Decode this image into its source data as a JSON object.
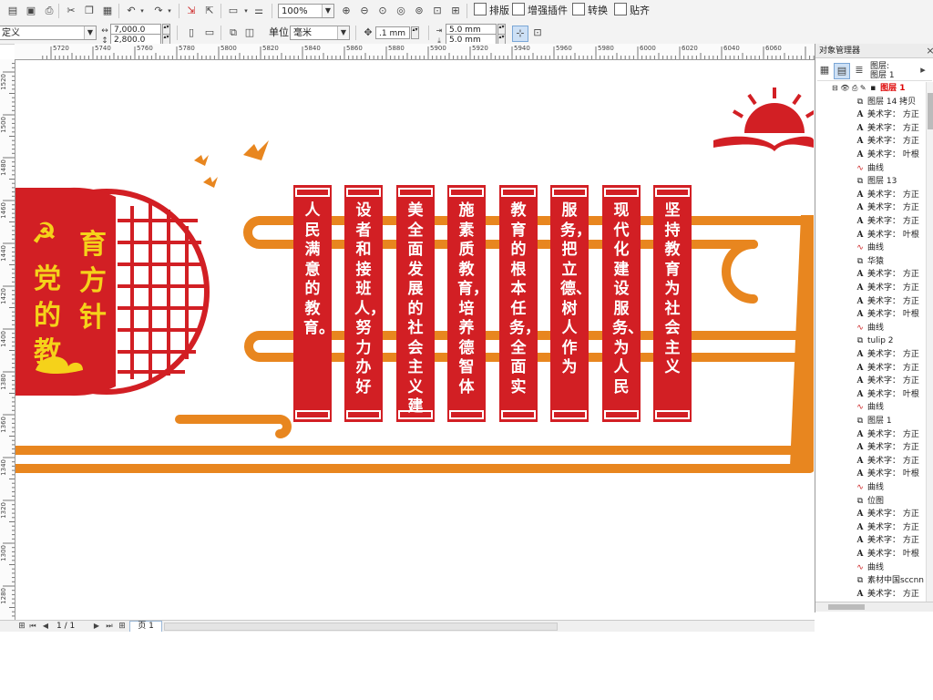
{
  "toolbar": {
    "zoom_value": "100%",
    "menu_paiban": "排版",
    "menu_plugin": "增强插件",
    "menu_convert": "转换",
    "menu_snap": "贴齐"
  },
  "property_bar": {
    "preset": "定义",
    "width": "7,000.0 mm",
    "height": "2,800.0 mm",
    "unit_label": "单位:",
    "unit_value": "毫米",
    "nudge": ".1 mm",
    "dup_x": "5.0 mm",
    "dup_y": "5.0 mm"
  },
  "ruler_h_labels": [
    "5720",
    "5740",
    "5760",
    "5780",
    "5800",
    "5820",
    "5840",
    "5860",
    "5880",
    "5900",
    "5920",
    "5940",
    "5960",
    "5980",
    "6000",
    "6020",
    "6040",
    "6060"
  ],
  "ruler_v_labels": [
    "1520",
    "1500",
    "1480",
    "1460",
    "1440",
    "1420",
    "1400",
    "1380",
    "1360",
    "1340",
    "1320",
    "1300",
    "1280"
  ],
  "artwork": {
    "circle_title": "党的教育方针",
    "banners": [
      "坚持教育为社会主义",
      "现代化建设服务、为人民",
      "服务，把立德、树人作为",
      "教育的根本任务，全面实",
      "施素质教育，培养德智体",
      "美全面发展的社会主义建",
      "设者和接班人，努力办好",
      "人民满意的教育。"
    ],
    "colors": {
      "red": "#d21f24",
      "orange": "#e8861f",
      "gold": "#f5d21a"
    }
  },
  "docker": {
    "title": "对象管理器",
    "header_label": "图层:",
    "header_value": "图层 1",
    "tree": [
      {
        "icon": "layer",
        "text": "图层 1",
        "indent": 0
      },
      {
        "icon": "group",
        "text": "图层 14 拷贝",
        "indent": 1
      },
      {
        "icon": "text",
        "text": "美术字： 方正",
        "indent": 1
      },
      {
        "icon": "text",
        "text": "美术字： 方正",
        "indent": 1
      },
      {
        "icon": "text",
        "text": "美术字： 方正",
        "indent": 1
      },
      {
        "icon": "text",
        "text": "美术字： 叶根",
        "indent": 1
      },
      {
        "icon": "curve",
        "text": "曲线",
        "indent": 1
      },
      {
        "icon": "group",
        "text": "图层 13",
        "indent": 1
      },
      {
        "icon": "text",
        "text": "美术字： 方正",
        "indent": 1
      },
      {
        "icon": "text",
        "text": "美术字： 方正",
        "indent": 1
      },
      {
        "icon": "text",
        "text": "美术字： 方正",
        "indent": 1
      },
      {
        "icon": "text",
        "text": "美术字： 叶根",
        "indent": 1
      },
      {
        "icon": "curve",
        "text": "曲线",
        "indent": 1
      },
      {
        "icon": "group",
        "text": "华猿",
        "indent": 1
      },
      {
        "icon": "text",
        "text": "美术字： 方正",
        "indent": 1
      },
      {
        "icon": "text",
        "text": "美术字： 方正",
        "indent": 1
      },
      {
        "icon": "text",
        "text": "美术字： 方正",
        "indent": 1
      },
      {
        "icon": "text",
        "text": "美术字： 叶根",
        "indent": 1
      },
      {
        "icon": "curve",
        "text": "曲线",
        "indent": 1
      },
      {
        "icon": "group",
        "text": "tulip 2",
        "indent": 1
      },
      {
        "icon": "text",
        "text": "美术字： 方正",
        "indent": 1
      },
      {
        "icon": "text",
        "text": "美术字： 方正",
        "indent": 1
      },
      {
        "icon": "text",
        "text": "美术字： 方正",
        "indent": 1
      },
      {
        "icon": "text",
        "text": "美术字： 叶根",
        "indent": 1
      },
      {
        "icon": "curve",
        "text": "曲线",
        "indent": 1
      },
      {
        "icon": "group",
        "text": "图层 1",
        "indent": 1
      },
      {
        "icon": "text",
        "text": "美术字： 方正",
        "indent": 1
      },
      {
        "icon": "text",
        "text": "美术字： 方正",
        "indent": 1
      },
      {
        "icon": "text",
        "text": "美术字： 方正",
        "indent": 1
      },
      {
        "icon": "text",
        "text": "美术字： 叶根",
        "indent": 1
      },
      {
        "icon": "curve",
        "text": "曲线",
        "indent": 1
      },
      {
        "icon": "group",
        "text": "位图",
        "indent": 1
      },
      {
        "icon": "text",
        "text": "美术字： 方正",
        "indent": 1
      },
      {
        "icon": "text",
        "text": "美术字： 方正",
        "indent": 1
      },
      {
        "icon": "text",
        "text": "美术字： 方正",
        "indent": 1
      },
      {
        "icon": "text",
        "text": "美术字： 叶根",
        "indent": 1
      },
      {
        "icon": "curve",
        "text": "曲线",
        "indent": 1
      },
      {
        "icon": "group",
        "text": "素材中国sccnn",
        "indent": 1
      },
      {
        "icon": "text",
        "text": "美术字： 方正",
        "indent": 1
      }
    ]
  },
  "status": {
    "page_counter": "1 / 1",
    "page_tab": "页 1"
  }
}
